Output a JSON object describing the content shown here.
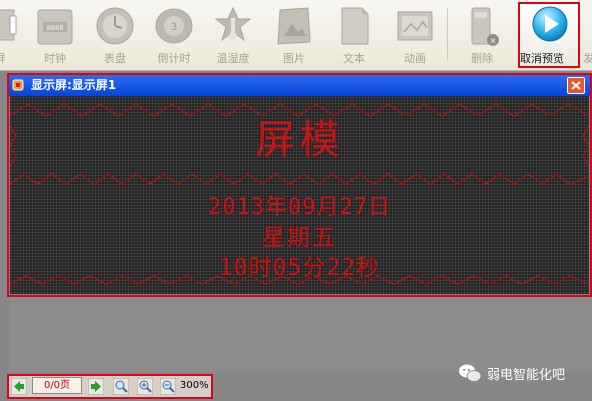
{
  "toolbar": {
    "items": [
      {
        "label": "屏",
        "icon": "screen-icon"
      },
      {
        "label": "时钟",
        "icon": "digital-clock-icon"
      },
      {
        "label": "表盘",
        "icon": "dial-icon"
      },
      {
        "label": "倒计时",
        "icon": "countdown-icon"
      },
      {
        "label": "温湿度",
        "icon": "thermometer-icon"
      },
      {
        "label": "图片",
        "icon": "picture-icon"
      },
      {
        "label": "文本",
        "icon": "text-icon"
      },
      {
        "label": "动画",
        "icon": "animation-icon"
      },
      {
        "label": "删除",
        "icon": "delete-icon"
      },
      {
        "label": "取消预览",
        "icon": "play-icon"
      },
      {
        "label": "发",
        "icon": "send-icon"
      }
    ]
  },
  "window": {
    "title": "显示屏:显示屏1",
    "display": {
      "title_text": "屏模",
      "date_text": "2013年09月27日",
      "weekday_text": "星期五",
      "time_text": "10时05分22秒"
    }
  },
  "nav": {
    "page": "0/0页",
    "zoom": "300%"
  },
  "watermark": {
    "text": "弱电智能化吧"
  },
  "colors": {
    "highlight": "#e0001a",
    "led_red": "#c01818",
    "title_bar": "#0645d8",
    "canvas_bg": "#878787"
  }
}
